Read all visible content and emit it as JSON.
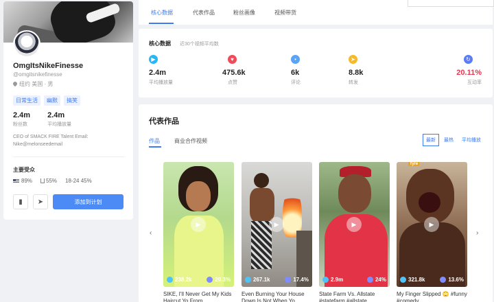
{
  "profile": {
    "name": "OmgItsNikeFinesse",
    "handle": "@omgitsnikefinesse",
    "location": "纽约 美国 · 男",
    "tags": [
      "日常生活",
      "幽默",
      "搞笑"
    ],
    "stats": [
      {
        "value": "2.4m",
        "label": "粉丝数"
      },
      {
        "value": "2.4m",
        "label": "平均播放量"
      }
    ],
    "bio": "CEO of SMACK FIRE Talent Email: Nike@melonseedemail",
    "audience_title": "主要受众",
    "audience": {
      "country": "89%",
      "gender": "55%",
      "age": "18-24 45%"
    },
    "cta_label": "添加到计划",
    "bookmark_icon": "bookmark-icon",
    "share_icon": "send-icon"
  },
  "tabs": [
    "核心数据",
    "代表作品",
    "粉丝画像",
    "视频带货"
  ],
  "core": {
    "title": "核心数据",
    "subtitle": "近30个视频平均数",
    "metrics": [
      {
        "icon": "play-icon",
        "color": "#27b7f5",
        "value": "2.4m",
        "label": "平均播放量"
      },
      {
        "icon": "heart-icon",
        "color": "#f04b5a",
        "value": "475.6k",
        "label": "点赞"
      },
      {
        "icon": "comment-icon",
        "color": "#5aa3f5",
        "value": "6k",
        "label": "评论"
      },
      {
        "icon": "share-icon",
        "color": "#f5b92a",
        "value": "8.8k",
        "label": "转发"
      },
      {
        "icon": "interaction-icon",
        "color": "#5b7cf5",
        "value": "20.11%",
        "label": "互动率"
      }
    ]
  },
  "works": {
    "title": "代表作品",
    "subtabs": [
      "作品",
      "商业合作视频"
    ],
    "sorts": [
      "最新",
      "最热",
      "平均播放"
    ],
    "videos": [
      {
        "views": "238.2k",
        "rate": "20.3%",
        "caption": "SIKE, I'll Never Get My Kids Haircut Yo From"
      },
      {
        "views": "267.1k",
        "rate": "17.4%",
        "caption": "Even Burning Your House Down Is Not When Yo"
      },
      {
        "views": "2.9m",
        "rate": "24%",
        "caption": "State Farm Vs. Allstate #statefarm #allstate"
      },
      {
        "views": "321.8k",
        "rate": "13.6%",
        "caption": "My Finger Slipped 🙄 #funny #comedy"
      }
    ],
    "video4_label": "Tyre"
  }
}
